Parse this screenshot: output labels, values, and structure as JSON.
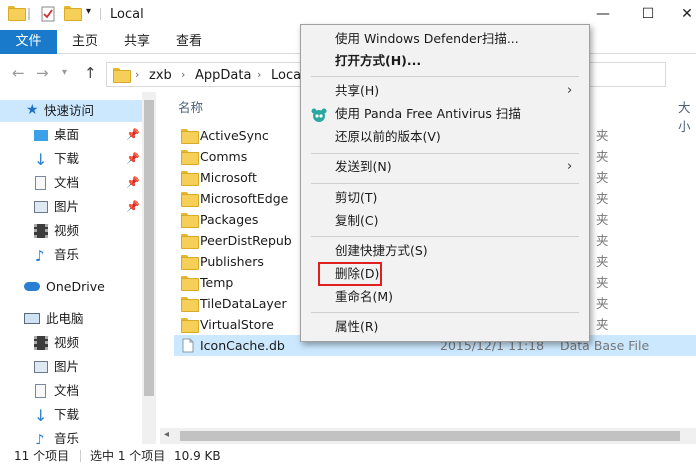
{
  "window": {
    "title": "Local",
    "minimize_glyph": "—",
    "maximize_glyph": "☐",
    "close_glyph": "✕"
  },
  "ribbon": {
    "tabs": [
      "文件",
      "主页",
      "共享",
      "查看"
    ],
    "file_tab_color": "#1979ca"
  },
  "address": {
    "crumbs": [
      "zxb",
      "AppData",
      "Local"
    ]
  },
  "nav": {
    "quick_access": "快速访问",
    "quick_items": [
      {
        "label": "桌面",
        "icon": "desktop-icon",
        "pinned": true
      },
      {
        "label": "下载",
        "icon": "download-icon",
        "pinned": true
      },
      {
        "label": "文档",
        "icon": "document-icon",
        "pinned": true
      },
      {
        "label": "图片",
        "icon": "picture-icon",
        "pinned": true
      },
      {
        "label": "视频",
        "icon": "video-icon",
        "pinned": false
      },
      {
        "label": "音乐",
        "icon": "music-icon",
        "pinned": false
      }
    ],
    "onedrive": "OneDrive",
    "this_pc": "此电脑",
    "pc_items": [
      {
        "label": "视频",
        "icon": "video-icon"
      },
      {
        "label": "图片",
        "icon": "picture-icon"
      },
      {
        "label": "文档",
        "icon": "document-icon"
      },
      {
        "label": "下载",
        "icon": "download-icon"
      },
      {
        "label": "音乐",
        "icon": "music-icon"
      }
    ]
  },
  "files": {
    "header_name": "名称",
    "header_size_partial": "大小",
    "folders": [
      "ActiveSync",
      "Comms",
      "Microsoft",
      "MicrosoftEdge",
      "Packages",
      "PeerDistRepub",
      "Publishers",
      "Temp",
      "TileDataLayer",
      "VirtualStore"
    ],
    "folder_type_partial": "夹",
    "selected_file": {
      "name": "IconCache.db",
      "date": "2015/12/1 11:18",
      "type": "Data Base File"
    }
  },
  "status": {
    "count": "11 个项目",
    "selection": "选中 1 个项目",
    "size": "10.9 KB"
  },
  "context_menu": {
    "items": [
      {
        "label": "使用 Windows Defender扫描...",
        "bold": false,
        "submenu": false
      },
      {
        "label": "打开方式(H)...",
        "bold": true,
        "submenu": false
      },
      {
        "separator": true
      },
      {
        "label": "共享(H)",
        "bold": false,
        "submenu": true
      },
      {
        "label": "使用 Panda Free Antivirus 扫描",
        "bold": false,
        "submenu": false,
        "icon": "panda-antivirus-icon"
      },
      {
        "label": "还原以前的版本(V)",
        "bold": false,
        "submenu": false
      },
      {
        "separator": true
      },
      {
        "label": "发送到(N)",
        "bold": false,
        "submenu": true
      },
      {
        "separator": true
      },
      {
        "label": "剪切(T)",
        "bold": false,
        "submenu": false
      },
      {
        "label": "复制(C)",
        "bold": false,
        "submenu": false
      },
      {
        "separator": true
      },
      {
        "label": "创建快捷方式(S)",
        "bold": false,
        "submenu": false
      },
      {
        "label": "删除(D)",
        "bold": false,
        "submenu": false,
        "highlighted": true
      },
      {
        "label": "重命名(M)",
        "bold": false,
        "submenu": false
      },
      {
        "separator": true
      },
      {
        "label": "属性(R)",
        "bold": false,
        "submenu": false
      }
    ],
    "highlight_color": "#e02020"
  }
}
